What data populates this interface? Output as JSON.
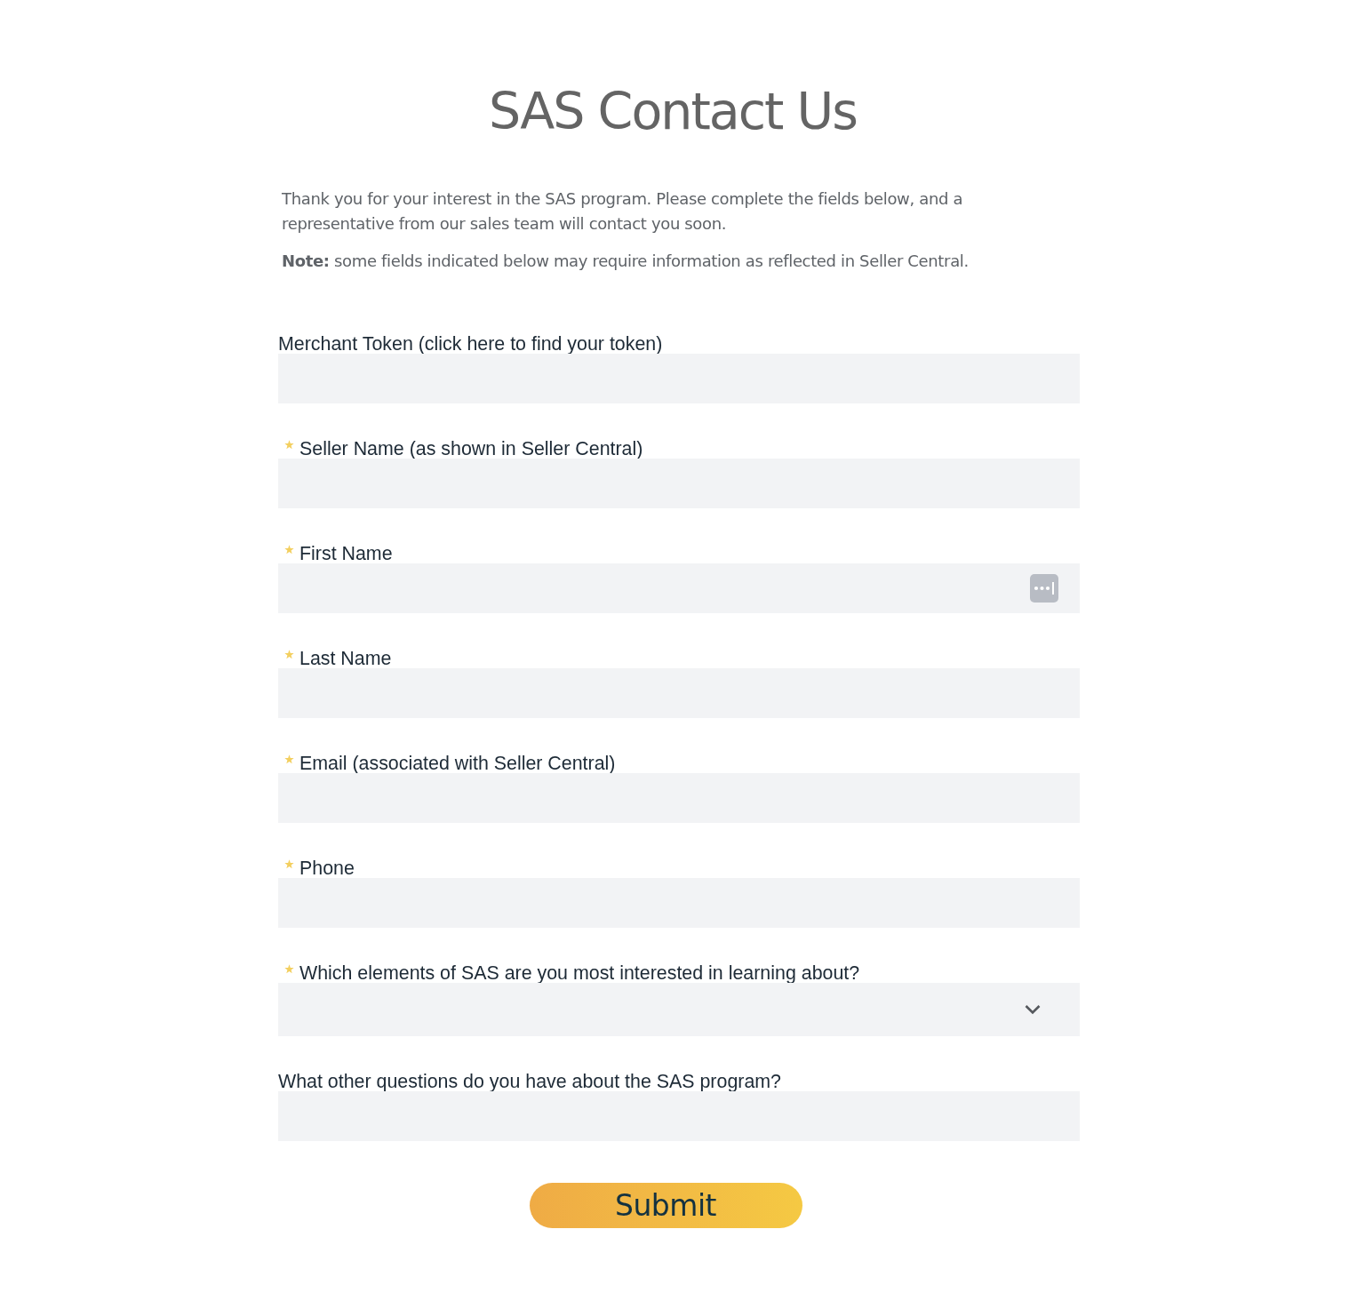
{
  "title": "SAS Contact Us",
  "intro": [
    "Thank you for your interest in the SAS program. Please complete the fields below, and a representative from our sales team will contact you soon.",
    "**Note:** some fields indicated below may require information as reflected in Seller Central."
  ],
  "fields": [
    {
      "label": "Merchant Token (click here to find your token)",
      "kind": "text",
      "required": false,
      "autofill": false
    },
    {
      "label": "Seller Name (as shown in Seller Central)",
      "kind": "text",
      "required": true,
      "autofill": false
    },
    {
      "label": "First Name",
      "kind": "text",
      "required": true,
      "autofill": true
    },
    {
      "label": "Last Name",
      "kind": "text",
      "required": true,
      "autofill": false
    },
    {
      "label": "Email (associated with Seller Central)",
      "kind": "text",
      "required": true,
      "autofill": false
    },
    {
      "label": "Phone",
      "kind": "text",
      "required": true,
      "autofill": false
    },
    {
      "label": "Which elements of SAS are you most interested in learning about?",
      "kind": "select",
      "required": true,
      "autofill": false
    },
    {
      "label": "What other questions do you have about the SAS program?",
      "kind": "text",
      "required": false,
      "autofill": false
    }
  ],
  "submit": "Submit"
}
